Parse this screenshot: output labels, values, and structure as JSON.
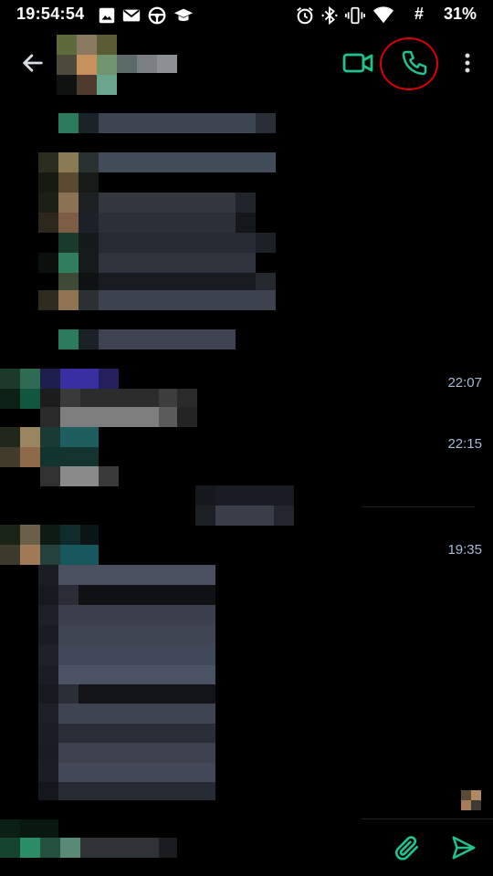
{
  "status_bar": {
    "time": "19:54:54",
    "network_label": "#",
    "battery_percent": "31%",
    "left_icons": [
      "image-icon",
      "mail-icon",
      "steering-wheel-icon",
      "graduation-cap-icon"
    ],
    "right_icons": [
      "alarm-icon",
      "bluetooth-icon",
      "vibrate-icon",
      "wifi-icon"
    ]
  },
  "app_bar": {
    "back_icon": "arrow-left-icon",
    "video_icon": "video-camera-icon",
    "call_icon": "phone-icon",
    "menu_icon": "more-vert-icon",
    "accent_color": "#1fc290",
    "highlight_color": "#e00000"
  },
  "messages": {
    "timestamps": [
      "22:07",
      "22:15",
      "19:35"
    ]
  },
  "composer": {
    "attach_icon": "paperclip-icon",
    "send_icon": "send-icon",
    "accent_color": "#1fc290"
  }
}
